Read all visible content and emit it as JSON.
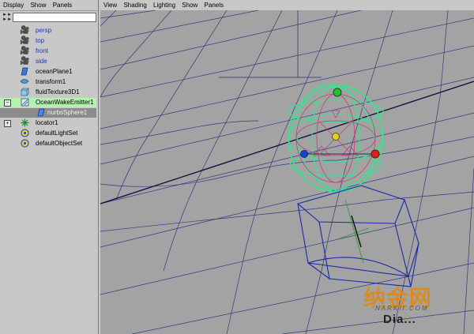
{
  "outliner": {
    "menu": [
      "Display",
      "Show",
      "Panels"
    ],
    "filter_value": "",
    "items": [
      {
        "label": "persp",
        "icon": "camera-icon",
        "label_color": "#1838b0"
      },
      {
        "label": "top",
        "icon": "camera-icon",
        "label_color": "#1838b0"
      },
      {
        "label": "front",
        "icon": "camera-icon",
        "label_color": "#1838b0"
      },
      {
        "label": "side",
        "icon": "camera-icon",
        "label_color": "#1838b0"
      },
      {
        "label": "oceanPlane1",
        "icon": "ocean-plane-icon"
      },
      {
        "label": "transform1",
        "icon": "transform-icon"
      },
      {
        "label": "fluidTexture3D1",
        "icon": "fluid-texture-icon"
      },
      {
        "label": "OceanWakeEmitter1",
        "icon": "emitter-icon",
        "selected": true,
        "expandable": true
      },
      {
        "label": "nurbsSphere1",
        "icon": "nurbs-icon",
        "child": true
      },
      {
        "label": "locator1",
        "icon": "locator-icon",
        "expandable": true
      },
      {
        "label": "defaultLightSet",
        "icon": "set-icon"
      },
      {
        "label": "defaultObjectSet",
        "icon": "set-icon"
      }
    ]
  },
  "viewport": {
    "menu": [
      "View",
      "Shading",
      "Lighting",
      "Show",
      "Panels"
    ]
  },
  "watermark": {
    "cn": "纳金网",
    "en": "NARKII.COM",
    "mark": "Dia..."
  },
  "colors": {
    "grid": "#2c2c7a",
    "emitter": "#30e890",
    "sphere": "#c04070",
    "box": "#1a2aa8",
    "selected_bg": "#b4f0ae"
  }
}
